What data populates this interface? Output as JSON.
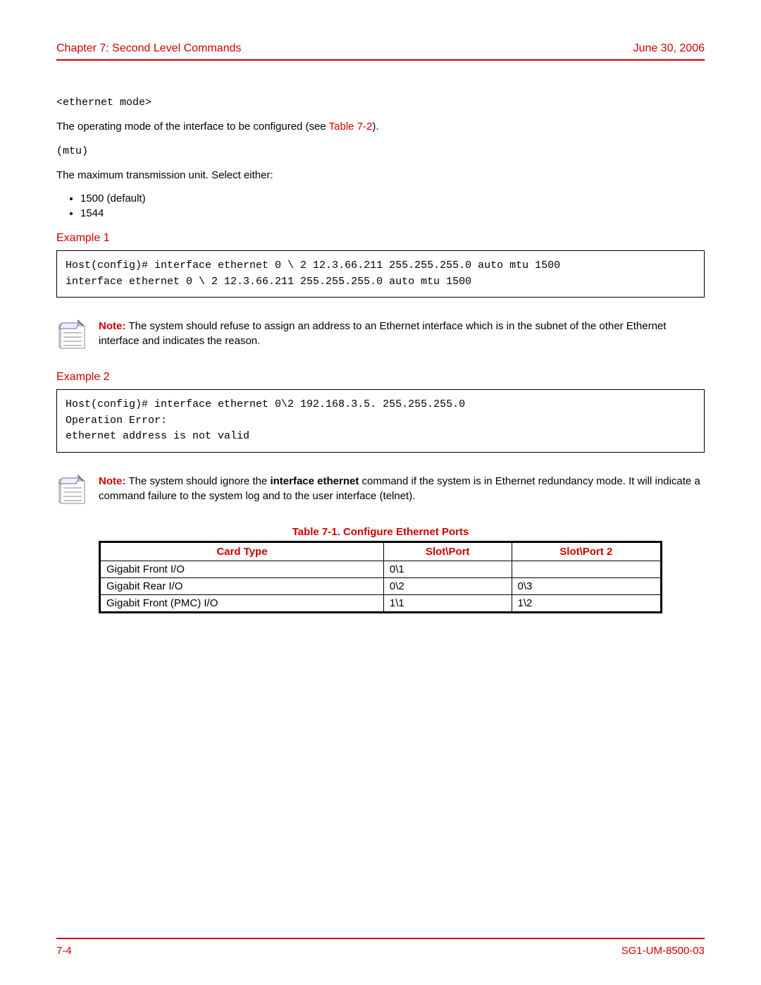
{
  "header": {
    "chapter": "Chapter 7: Second Level Commands",
    "date": "June 30, 2006"
  },
  "body": {
    "ethernet_mode_label": "<ethernet mode>",
    "ethernet_mode_desc_pre": "The operating mode of the interface to be configured (see ",
    "ethernet_mode_desc_link": "Table 7-2",
    "ethernet_mode_desc_post": ").",
    "mtu_label": "(mtu)",
    "mtu_desc": "The maximum transmission unit. Select either:",
    "mtu_options": [
      "1500 (default)",
      "1544"
    ],
    "example1_title": "Example 1",
    "example1_code": "Host(config)# interface ethernet 0 \\ 2 12.3.66.211 255.255.255.0 auto mtu 1500\ninterface ethernet 0 \\ 2 12.3.66.211 255.255.255.0 auto mtu 1500",
    "note1_bold": "Note: ",
    "note1_text": "The system should refuse to assign an address to an Ethernet interface which is in the subnet of the other Ethernet interface and indicates the reason.",
    "example2_title": "Example 2",
    "example2_code": "Host(config)# interface ethernet 0\\2 192.168.3.5. 255.255.255.0\nOperation Error:\nethernet address is not valid",
    "note2_bold": "Note: ",
    "note2_pre": "The system should ignore the ",
    "note2_cmd": "interface ethernet",
    "note2_post": " command if the system is in Ethernet redundancy mode. It will indicate a command failure to the system log and to the user interface (telnet).",
    "table_title": "Table 7-1. Configure Ethernet Ports",
    "table_headers": [
      "Card Type",
      "Slot\\Port",
      "Slot\\Port 2"
    ],
    "table_rows": [
      [
        "Gigabit Front I/O",
        "0\\1",
        ""
      ],
      [
        "Gigabit Rear I/O",
        "0\\2",
        "0\\3"
      ],
      [
        "Gigabit Front (PMC) I/O",
        "1\\1",
        "1\\2"
      ]
    ]
  },
  "footer": {
    "page": "7-4",
    "docid": "SG1-UM-8500-03"
  },
  "chart_data": {
    "type": "table",
    "title": "Table 7-1. Configure Ethernet Ports",
    "columns": [
      "Card Type",
      "Slot\\Port",
      "Slot\\Port 2"
    ],
    "rows": [
      {
        "Card Type": "Gigabit Front I/O",
        "Slot\\Port": "0\\1",
        "Slot\\Port 2": ""
      },
      {
        "Card Type": "Gigabit Rear I/O",
        "Slot\\Port": "0\\2",
        "Slot\\Port 2": "0\\3"
      },
      {
        "Card Type": "Gigabit Front (PMC) I/O",
        "Slot\\Port": "1\\1",
        "Slot\\Port 2": "1\\2"
      }
    ]
  }
}
